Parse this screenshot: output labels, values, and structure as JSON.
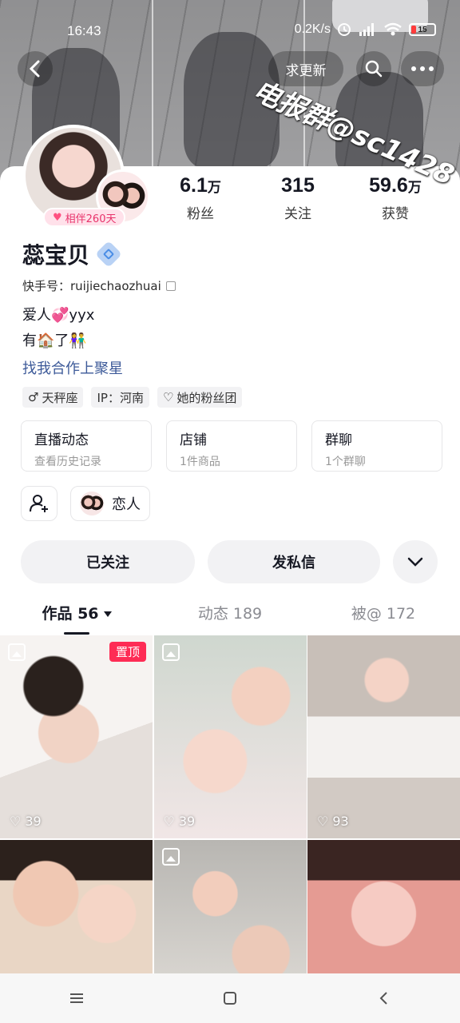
{
  "status_bar": {
    "time": "16:43",
    "net_speed": "0.2K/s",
    "battery": "15"
  },
  "header": {
    "request_update": "求更新",
    "watermark": "电报群@sc1428"
  },
  "profile": {
    "pair_badge": "相伴260天",
    "name": "蕊宝贝",
    "kuaishou_id": "快手号：ruijiechaozhuai",
    "bio_line1": "爱人💞yyx",
    "bio_line2": "有🏠了👫",
    "link_text": "找我合作上聚星"
  },
  "stats": [
    {
      "num": "6.1",
      "unit": "万",
      "label": "粉丝"
    },
    {
      "num": "315",
      "unit": "",
      "label": "关注"
    },
    {
      "num": "59.6",
      "unit": "万",
      "label": "获赞"
    }
  ],
  "tags": [
    {
      "icon": "male-symbol-icon",
      "text": "天秤座"
    },
    {
      "icon": "",
      "text": "IP：河南"
    },
    {
      "icon": "heart-outline-icon",
      "text": "她的粉丝团"
    }
  ],
  "cards": [
    {
      "title": "直播动态",
      "sub": "查看历史记录"
    },
    {
      "title": "店铺",
      "sub": "1件商品"
    },
    {
      "title": "群聊",
      "sub": "1个群聊"
    }
  ],
  "relation": {
    "lover_label": "恋人"
  },
  "actions": {
    "follow": "已关注",
    "message": "发私信"
  },
  "tabs": [
    {
      "label": "作品 56",
      "active": true
    },
    {
      "label": "动态 189",
      "active": false
    },
    {
      "label": "被@ 172",
      "active": false
    }
  ],
  "grid": [
    {
      "likes": "39",
      "pinned": "置顶",
      "image_post": true
    },
    {
      "likes": "39",
      "pinned": "",
      "image_post": true
    },
    {
      "likes": "93",
      "pinned": "",
      "image_post": false
    },
    {
      "likes": "",
      "pinned": "",
      "image_post": false
    },
    {
      "likes": "",
      "pinned": "",
      "image_post": true
    },
    {
      "likes": "",
      "pinned": "",
      "image_post": false
    }
  ],
  "colors": {
    "accent_red": "#fe2c55",
    "link_blue": "#3d5a99",
    "badge_pink": "#e8336b"
  }
}
